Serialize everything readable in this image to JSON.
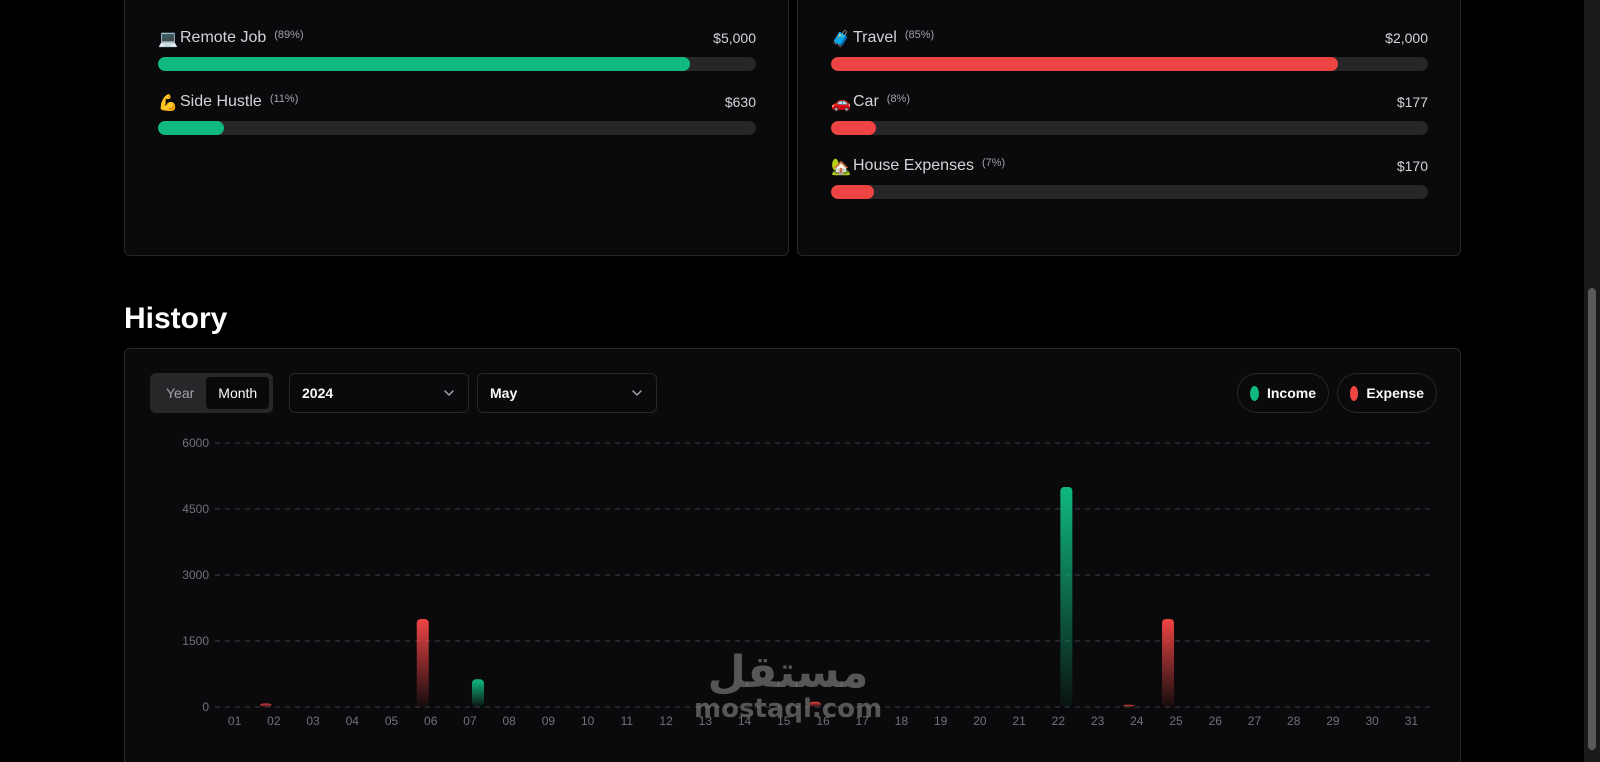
{
  "income_categories": [
    {
      "emoji": "💻",
      "name": "Remote Job",
      "pct": "(89%)",
      "amount": "$5,000",
      "fill": 0.89
    },
    {
      "emoji": "💪",
      "name": "Side Hustle",
      "pct": "(11%)",
      "amount": "$630",
      "fill": 0.11
    }
  ],
  "expense_categories": [
    {
      "emoji": "🧳",
      "name": "Travel",
      "pct": "(85%)",
      "amount": "$2,000",
      "fill": 0.85
    },
    {
      "emoji": "🚗",
      "name": "Car",
      "pct": "(8%)",
      "amount": "$177",
      "fill": 0.075
    },
    {
      "emoji": "🏡",
      "name": "House Expenses",
      "pct": "(7%)",
      "amount": "$170",
      "fill": 0.072
    }
  ],
  "history": {
    "title": "History",
    "toggle": {
      "year_label": "Year",
      "month_label": "Month",
      "active": "Month"
    },
    "year_select": "2024",
    "month_select": "May",
    "legend": {
      "income": "Income",
      "expense": "Expense"
    }
  },
  "colors": {
    "income": "#10b981",
    "expense": "#ef4444"
  },
  "watermark": {
    "arabic": "مستقل",
    "latin": "mostaql.com"
  },
  "chart_data": {
    "type": "bar",
    "categories": [
      "01",
      "02",
      "03",
      "04",
      "05",
      "06",
      "07",
      "08",
      "09",
      "10",
      "11",
      "12",
      "13",
      "14",
      "15",
      "16",
      "17",
      "18",
      "19",
      "20",
      "21",
      "22",
      "23",
      "24",
      "25",
      "26",
      "27",
      "28",
      "29",
      "30",
      "31"
    ],
    "series": [
      {
        "name": "Income",
        "values": [
          0,
          0,
          0,
          0,
          0,
          0,
          630,
          0,
          0,
          0,
          0,
          0,
          0,
          0,
          0,
          0,
          0,
          0,
          0,
          0,
          0,
          5000,
          0,
          0,
          0,
          0,
          0,
          0,
          0,
          0,
          0
        ]
      },
      {
        "name": "Expense",
        "values": [
          0,
          80,
          0,
          0,
          0,
          2000,
          0,
          0,
          0,
          0,
          0,
          0,
          0,
          0,
          0,
          120,
          0,
          0,
          0,
          0,
          0,
          0,
          0,
          50,
          2000,
          0,
          0,
          0,
          0,
          0,
          0
        ]
      }
    ],
    "yticks": [
      0,
      1500,
      3000,
      4500,
      6000
    ],
    "ylim": [
      0,
      6000
    ],
    "grid": true,
    "legend_position": "top-right"
  }
}
